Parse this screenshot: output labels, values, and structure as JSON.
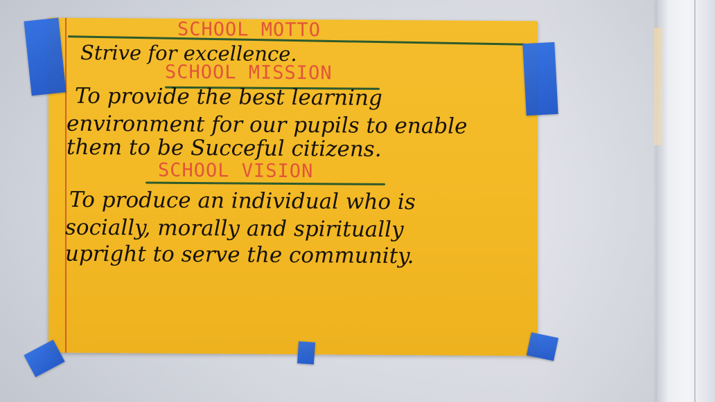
{
  "poster": {
    "motto_heading": "SCHOOL MOTTO",
    "motto_text": "Strive for excellence.",
    "mission_heading": "SCHOOL MISSION",
    "mission_lines": [
      "To provide the best learning",
      "environment for our pupils to enable",
      "them to be Succeful citizens."
    ],
    "vision_heading": "SCHOOL VISION",
    "vision_lines": [
      "To produce an individual who is",
      "socially, morally and spiritually",
      "upright to serve the community."
    ]
  },
  "colors": {
    "paper": "#f3b925",
    "heading_ink": "#e2543a",
    "body_ink": "#15110c",
    "rule": "#2e5a2c",
    "tape": "#2663d9"
  }
}
